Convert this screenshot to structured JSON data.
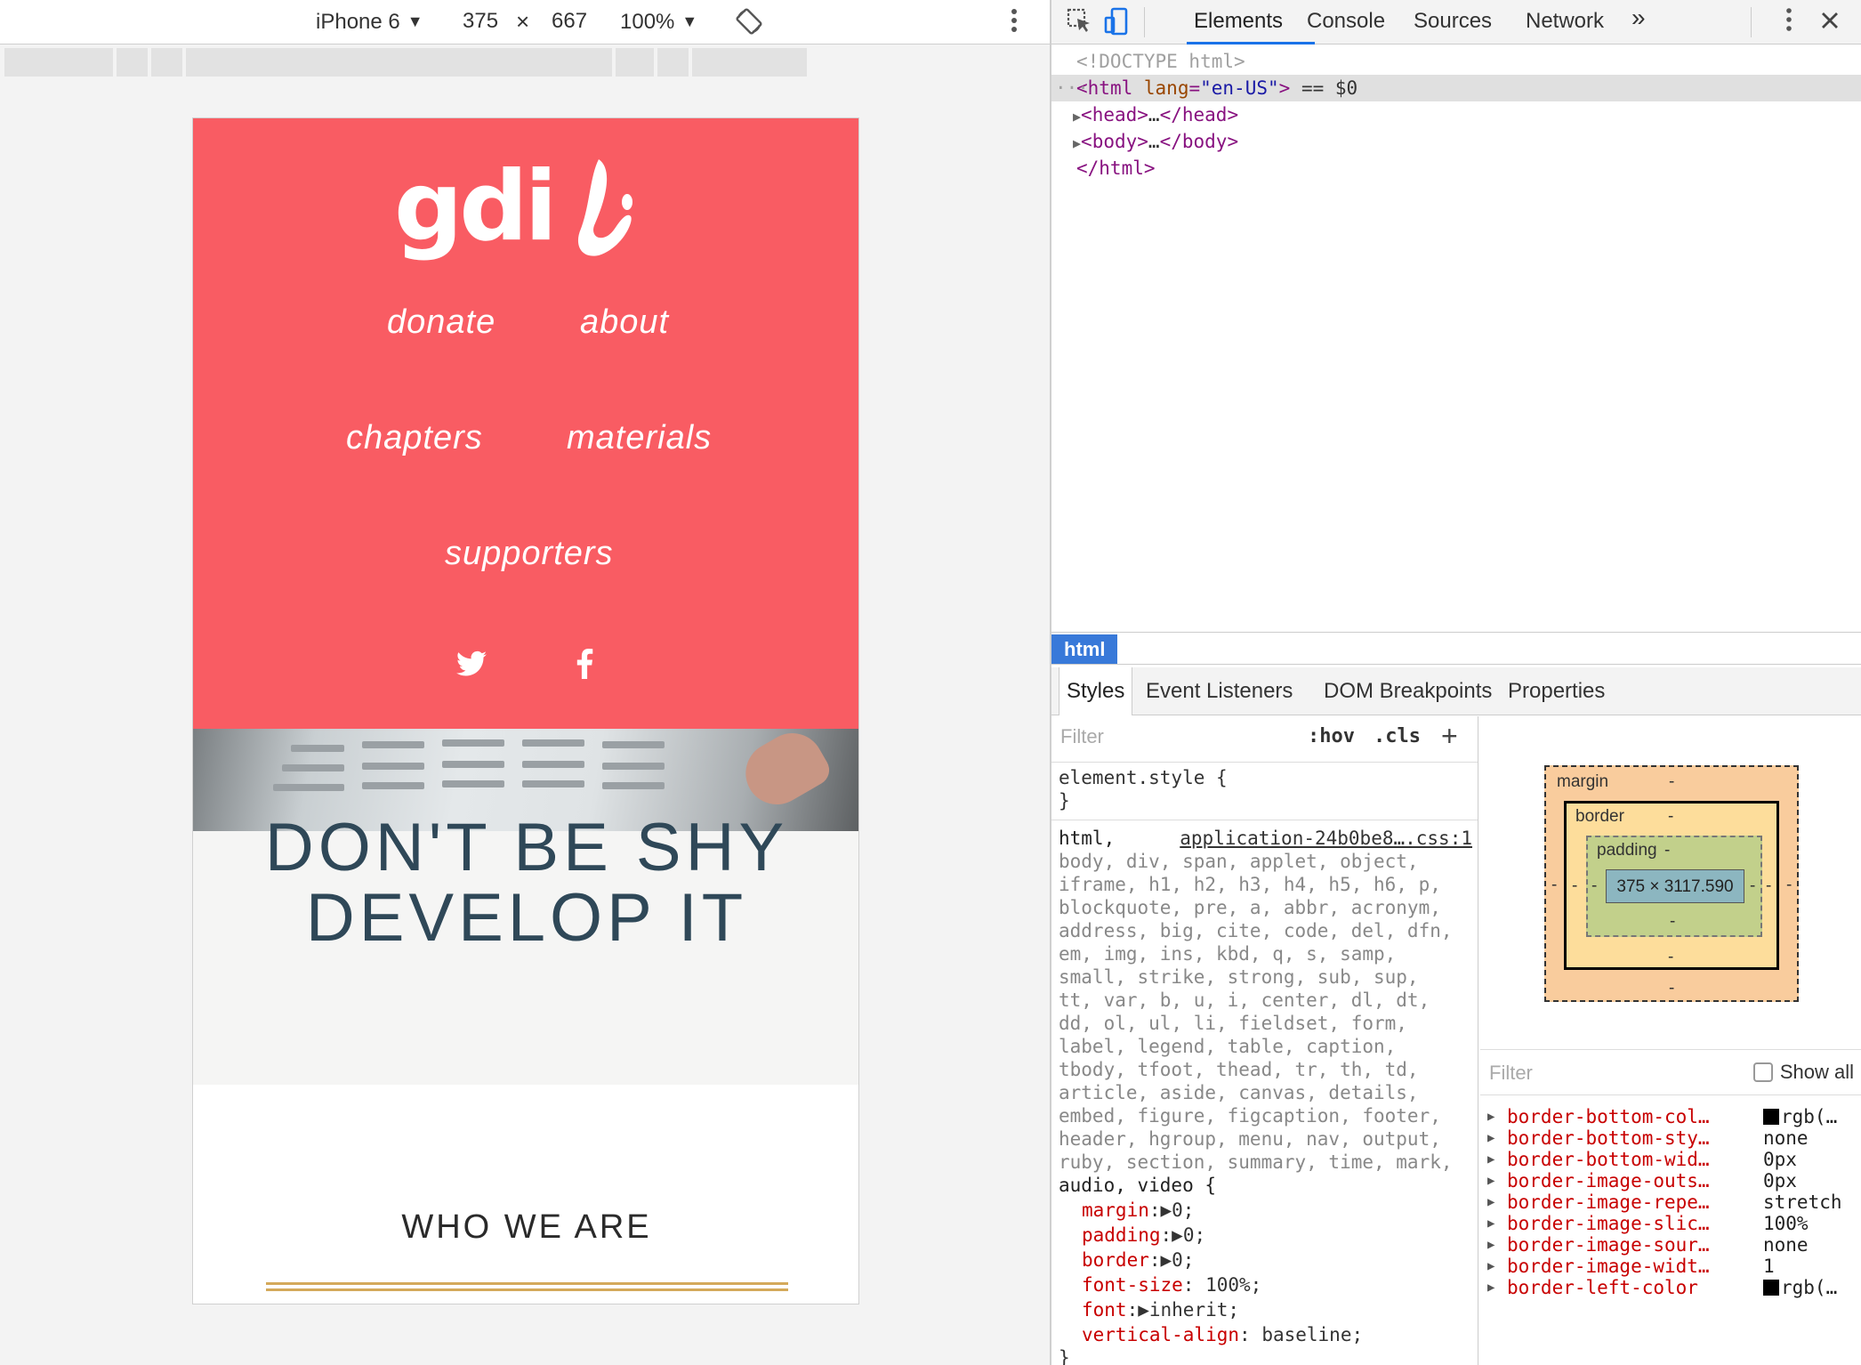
{
  "device_toolbar": {
    "device": "iPhone 6",
    "width": "375",
    "times": "×",
    "height": "667",
    "zoom": "100%",
    "caret": "▼",
    "rotate_icon": "rotate-icon",
    "more_icon": "more-vert-icon"
  },
  "site": {
    "logo_text": "gdi",
    "nav": [
      "donate",
      "about",
      "chapters",
      "materials",
      "supporters"
    ],
    "social_icons": [
      "twitter-icon",
      "facebook-icon"
    ],
    "hero_title_line1": "DON'T BE SHY",
    "hero_title_line2": "DEVELOP IT",
    "section_title": "WHO WE ARE",
    "colors": {
      "header": "#f95c63",
      "hero_title": "#2f4858",
      "rule": "#d4a95a"
    }
  },
  "devtools": {
    "tabs": [
      "Elements",
      "Console",
      "Sources",
      "Network"
    ],
    "overflow": "»",
    "elements_tree": {
      "doctype": "<!DOCTYPE html>",
      "html_open_tag": "html",
      "html_attr_name": "lang",
      "html_attr_value": "\"en-US\"",
      "selected_marker": "== $0",
      "head": "head",
      "body": "body",
      "ellipsis": "…",
      "html_close": "</html>"
    },
    "breadcrumb": "html",
    "sub_tabs": [
      "Styles",
      "Event Listeners",
      "DOM Breakpoints",
      "Properties"
    ],
    "styles": {
      "filter_placeholder": "Filter",
      "hov": ":hov",
      "cls": ".cls",
      "plus": "+",
      "element_style": "element.style {",
      "close_brace": "}",
      "rule_selector_first": "html,",
      "source": "application-24b0be8….css:1",
      "selector_lines": [
        "body, div, span, applet, object,",
        "iframe, h1, h2, h3, h4, h5, h6, p,",
        "blockquote, pre, a, abbr, acronym,",
        "address, big, cite, code, del, dfn,",
        "em, img, ins, kbd, q, s, samp,",
        "small, strike, strong, sub, sup,",
        "tt, var, b, u, i, center, dl, dt,",
        "dd, ol, ul, li, fieldset, form,",
        "label, legend, table, caption,",
        "tbody, tfoot, thead, tr, th, td,",
        "article, aside, canvas, details,",
        "embed, figure, figcaption, footer,",
        "header, hgroup, menu, nav, output,",
        "ruby, section, summary, time, mark,",
        "audio, video {"
      ],
      "declarations": [
        {
          "name": "margin",
          "sep": ":",
          "value": "▶0;"
        },
        {
          "name": "padding",
          "sep": ":",
          "value": "▶0;"
        },
        {
          "name": "border",
          "sep": ":",
          "value": "▶0;"
        },
        {
          "name": "font-size",
          "sep": ":",
          "value": " 100%;"
        },
        {
          "name": "font",
          "sep": ":",
          "value": "▶inherit;"
        },
        {
          "name": "vertical-align",
          "sep": ":",
          "value": " baseline;"
        }
      ]
    },
    "box_model": {
      "margin_label": "margin",
      "border_label": "border",
      "padding_label": "padding",
      "dash": "-",
      "content": "375 × 3117.590"
    },
    "computed": {
      "filter_placeholder": "Filter",
      "show_all": "Show all",
      "rows": [
        {
          "name": "border-bottom-col…",
          "value": "rgb(…",
          "swatch": true
        },
        {
          "name": "border-bottom-sty…",
          "value": "none"
        },
        {
          "name": "border-bottom-wid…",
          "value": "0px"
        },
        {
          "name": "border-image-outs…",
          "value": "0px"
        },
        {
          "name": "border-image-repe…",
          "value": "stretch"
        },
        {
          "name": "border-image-slic…",
          "value": "100%"
        },
        {
          "name": "border-image-sour…",
          "value": "none"
        },
        {
          "name": "border-image-widt…",
          "value": "1"
        },
        {
          "name": "border-left-color",
          "value": "rgb(…",
          "swatch": true
        }
      ]
    }
  }
}
